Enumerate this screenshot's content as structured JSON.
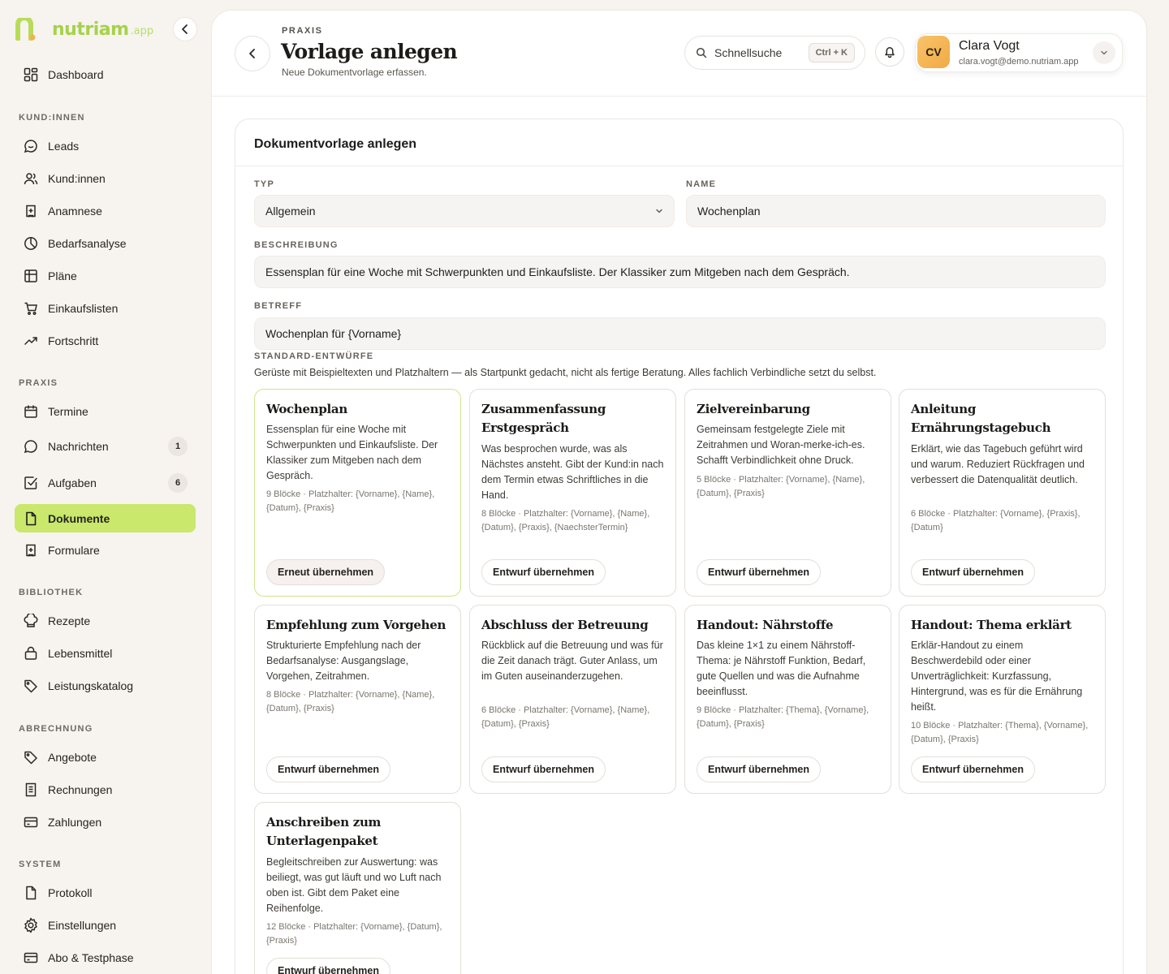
{
  "brand": {
    "name": "nutriam",
    "tld": ".app",
    "accent": "#c9e86c"
  },
  "sidebar": {
    "dashboard": "Dashboard",
    "sections": {
      "clients": "KUND:INNEN",
      "practice": "PRAXIS",
      "library": "BIBLIOTHEK",
      "billing": "ABRECHNUNG",
      "system": "SYSTEM"
    },
    "items": {
      "leads": "Leads",
      "clients": "Kund:innen",
      "anamnese": "Anamnese",
      "bedarfsanalyse": "Bedarfsanalyse",
      "plaene": "Pläne",
      "einkaufslisten": "Einkaufslisten",
      "fortschritt": "Fortschritt",
      "termine": "Termine",
      "nachrichten": "Nachrichten",
      "nachrichten_badge": "1",
      "aufgaben": "Aufgaben",
      "aufgaben_badge": "6",
      "dokumente": "Dokumente",
      "formulare": "Formulare",
      "rezepte": "Rezepte",
      "lebensmittel": "Lebensmittel",
      "leistungskatalog": "Leistungskatalog",
      "angebote": "Angebote",
      "rechnungen": "Rechnungen",
      "zahlungen": "Zahlungen",
      "protokoll": "Protokoll",
      "einstellungen": "Einstellungen",
      "abo": "Abo & Testphase"
    }
  },
  "header": {
    "eyebrow": "PRAXIS",
    "title": "Vorlage anlegen",
    "subtitle": "Neue Dokumentvorlage erfassen.",
    "search_placeholder": "Schnellsuche",
    "search_shortcut": "Ctrl + K",
    "user": {
      "initials": "CV",
      "name": "Clara Vogt",
      "email": "clara.vogt@demo.nutriam.app"
    }
  },
  "form": {
    "card_title": "Dokumentvorlage anlegen",
    "type_label": "TYP",
    "type_value": "Allgemein",
    "name_label": "NAME",
    "name_value": "Wochenplan",
    "description_label": "BESCHREIBUNG",
    "description_value": "Essensplan für eine Woche mit Schwerpunkten und Einkaufsliste. Der Klassiker zum Mitgeben nach dem Gespräch.",
    "subject_label": "BETREFF",
    "subject_value": "Wochenplan für {Vorname}",
    "drafts_label": "STANDARD-ENTWÜRFE",
    "drafts_hint": "Gerüste mit Beispieltexten und Platzhaltern — als Startpunkt gedacht, nicht als fertige Beratung. Alles fachlich Verbindliche setzt du selbst."
  },
  "templates": [
    {
      "title": "Wochenplan",
      "desc": "Essensplan für eine Woche mit Schwerpunkten und Einkaufsliste. Der Klassiker zum Mitgeben nach dem Gespräch.",
      "meta": "9 Blöcke · Platzhalter: {Vorname}, {Name}, {Datum}, {Praxis}",
      "button": "Erneut übernehmen",
      "selected": true
    },
    {
      "title": "Zusammenfassung Erstgespräch",
      "desc": "Was besprochen wurde, was als Nächstes ansteht. Gibt der Kund:in nach dem Termin etwas Schriftliches in die Hand.",
      "meta": "8 Blöcke · Platzhalter: {Vorname}, {Name}, {Datum}, {Praxis}, {NaechsterTermin}",
      "button": "Entwurf übernehmen"
    },
    {
      "title": "Zielvereinbarung",
      "desc": "Gemeinsam festgelegte Ziele mit Zeitrahmen und Woran-merke-ich-es. Schafft Verbindlichkeit ohne Druck.",
      "meta": "5 Blöcke · Platzhalter: {Vorname}, {Name}, {Datum}, {Praxis}",
      "button": "Entwurf übernehmen"
    },
    {
      "title": "Anleitung Ernährungstagebuch",
      "desc": "Erklärt, wie das Tagebuch geführt wird und warum. Reduziert Rückfragen und verbessert die Datenqualität deutlich.",
      "meta": "6 Blöcke · Platzhalter: {Vorname}, {Praxis}, {Datum}",
      "button": "Entwurf übernehmen"
    },
    {
      "title": "Empfehlung zum Vorgehen",
      "desc": "Strukturierte Empfehlung nach der Bedarfsanalyse: Ausgangslage, Vorgehen, Zeitrahmen.",
      "meta": "8 Blöcke · Platzhalter: {Vorname}, {Name}, {Datum}, {Praxis}",
      "button": "Entwurf übernehmen"
    },
    {
      "title": "Abschluss der Betreuung",
      "desc": "Rückblick auf die Betreuung und was für die Zeit danach trägt. Guter Anlass, um im Guten auseinanderzugehen.",
      "meta": "6 Blöcke · Platzhalter: {Vorname}, {Name}, {Datum}, {Praxis}",
      "button": "Entwurf übernehmen"
    },
    {
      "title": "Handout: Nährstoffe",
      "desc": "Das kleine 1×1 zu einem Nährstoff-Thema: je Nährstoff Funktion, Bedarf, gute Quellen und was die Aufnahme beeinflusst.",
      "meta": "9 Blöcke · Platzhalter: {Thema}, {Vorname}, {Datum}, {Praxis}",
      "button": "Entwurf übernehmen"
    },
    {
      "title": "Handout: Thema erklärt",
      "desc": "Erklär-Handout zu einem Beschwerdebild oder einer Unverträglichkeit: Kurzfassung, Hintergrund, was es für die Ernährung heißt.",
      "meta": "10 Blöcke · Platzhalter: {Thema}, {Vorname}, {Datum}, {Praxis}",
      "button": "Entwurf übernehmen"
    },
    {
      "title": "Anschreiben zum Unterlagenpaket",
      "desc": "Begleitschreiben zur Auswertung: was beiliegt, was gut läuft und wo Luft nach oben ist. Gibt dem Paket eine Reihenfolge.",
      "meta": "12 Blöcke · Platzhalter: {Vorname}, {Datum}, {Praxis}",
      "button": "Entwurf übernehmen"
    }
  ]
}
